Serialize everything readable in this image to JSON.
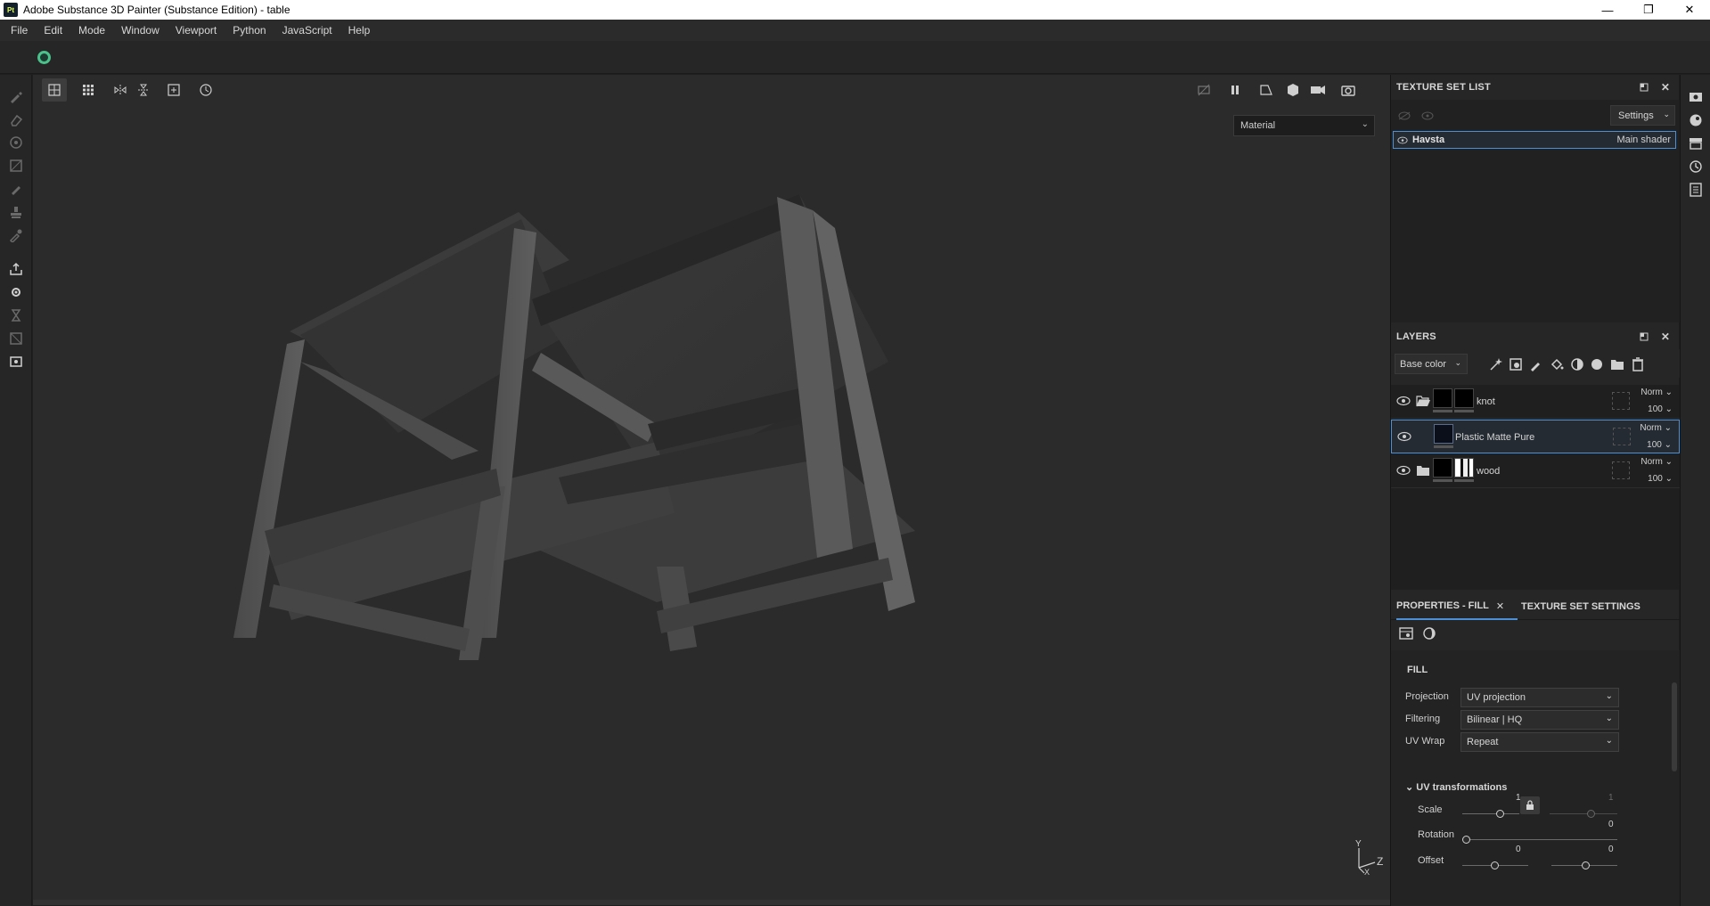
{
  "window": {
    "app_badge": "Pt",
    "title": "Adobe Substance 3D Painter (Substance Edition) - table",
    "controls": [
      "—",
      "❐",
      "✕"
    ]
  },
  "menu": [
    "File",
    "Edit",
    "Mode",
    "Window",
    "Viewport",
    "Python",
    "JavaScript",
    "Help"
  ],
  "viewport": {
    "display_mode": "Material",
    "axis_labels": {
      "y": "Y",
      "z": "Z",
      "x": "X"
    },
    "tool_icons": [
      "grid-2x2-icon",
      "grid-3x3-icon",
      "mirror-icon",
      "symmetry-icon",
      "frame-icon",
      "history-icon"
    ],
    "right_icons": [
      "hide-icon",
      "pause-icon",
      "perspective-icon",
      "cube-icon",
      "camera-icon",
      "screenshot-icon"
    ]
  },
  "texture_set_list": {
    "title": "TEXTURE SET LIST",
    "settings_label": "Settings",
    "items": [
      {
        "name": "Havsta",
        "shader": "Main shader"
      }
    ]
  },
  "layers": {
    "title": "LAYERS",
    "channel": "Base color",
    "items": [
      {
        "name": "knot",
        "blend": "Norm",
        "opacity": "100",
        "type": "folder-open"
      },
      {
        "name": "Plastic Matte Pure",
        "blend": "Norm",
        "opacity": "100",
        "type": "fill",
        "selected": true
      },
      {
        "name": "wood",
        "blend": "Norm",
        "opacity": "100",
        "type": "folder"
      }
    ]
  },
  "properties": {
    "tab_active": "PROPERTIES - FILL",
    "tab_other": "TEXTURE SET SETTINGS",
    "section": "FILL",
    "projection_label": "Projection",
    "projection_value": "UV projection",
    "filtering_label": "Filtering",
    "filtering_value": "Bilinear | HQ",
    "uvwrap_label": "UV Wrap",
    "uvwrap_value": "Repeat",
    "uv_transform_title": "UV transformations",
    "scale_label": "Scale",
    "scale_value_1": "1",
    "scale_value_2": "1",
    "rotation_label": "Rotation",
    "rotation_value": "0",
    "offset_label": "Offset",
    "offset_value_1": "0",
    "offset_value_2": "0"
  },
  "colors": {
    "accent": "#4a8fd8",
    "indicator": "#49c28b"
  }
}
